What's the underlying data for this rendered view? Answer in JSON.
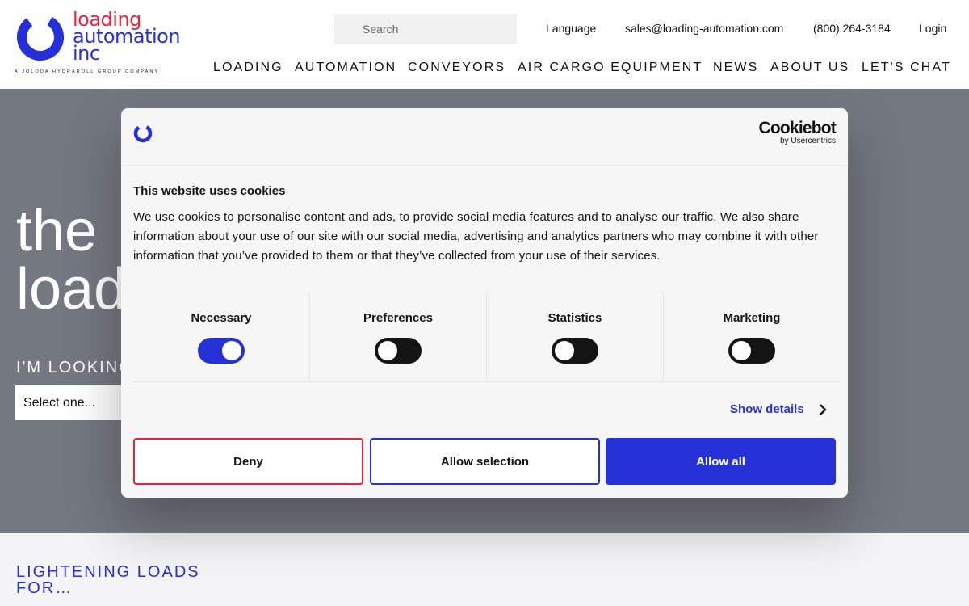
{
  "brand": {
    "logo_line1": "loading",
    "logo_line2": "automation",
    "logo_line3": "inc",
    "tagline": "A JOLODA HYDRAROLL GROUP COMPANY",
    "red": "#e8243c",
    "blue": "#2530d8"
  },
  "topbar": {
    "search_placeholder": "Search",
    "language": "Language",
    "email": "sales@loading-automation.com",
    "phone": "(800) 264-3184",
    "login": "Login"
  },
  "nav": {
    "items": [
      "LOADING",
      "AUTOMATION",
      "CONVEYORS",
      "AIR CARGO EQUIPMENT",
      "NEWS",
      "ABOUT US",
      "LET'S CHAT"
    ]
  },
  "hero": {
    "title_line1": "the",
    "title_line2": "load",
    "looking_label": "I'M LOOKING",
    "select_value": "Select one..."
  },
  "lower": {
    "heading": "LIGHTENING LOADS FOR…"
  },
  "cookie_dialog": {
    "brand_name": "Cookiebot",
    "brand_sub": "by Usercentrics",
    "title": "This website uses cookies",
    "body": "We use cookies to personalise content and ads, to provide social media features and to analyse our traffic. We also share information about your use of our site with our social media, advertising and analytics partners who may combine it with other information that you’ve provided to them or that they’ve collected from your use of their services.",
    "categories": [
      {
        "label": "Necessary",
        "enabled": true
      },
      {
        "label": "Preferences",
        "enabled": false
      },
      {
        "label": "Statistics",
        "enabled": false
      },
      {
        "label": "Marketing",
        "enabled": false
      }
    ],
    "show_details": "Show details",
    "deny": "Deny",
    "allow_selection": "Allow selection",
    "allow_all": "Allow all",
    "accent": "#2632d7"
  }
}
